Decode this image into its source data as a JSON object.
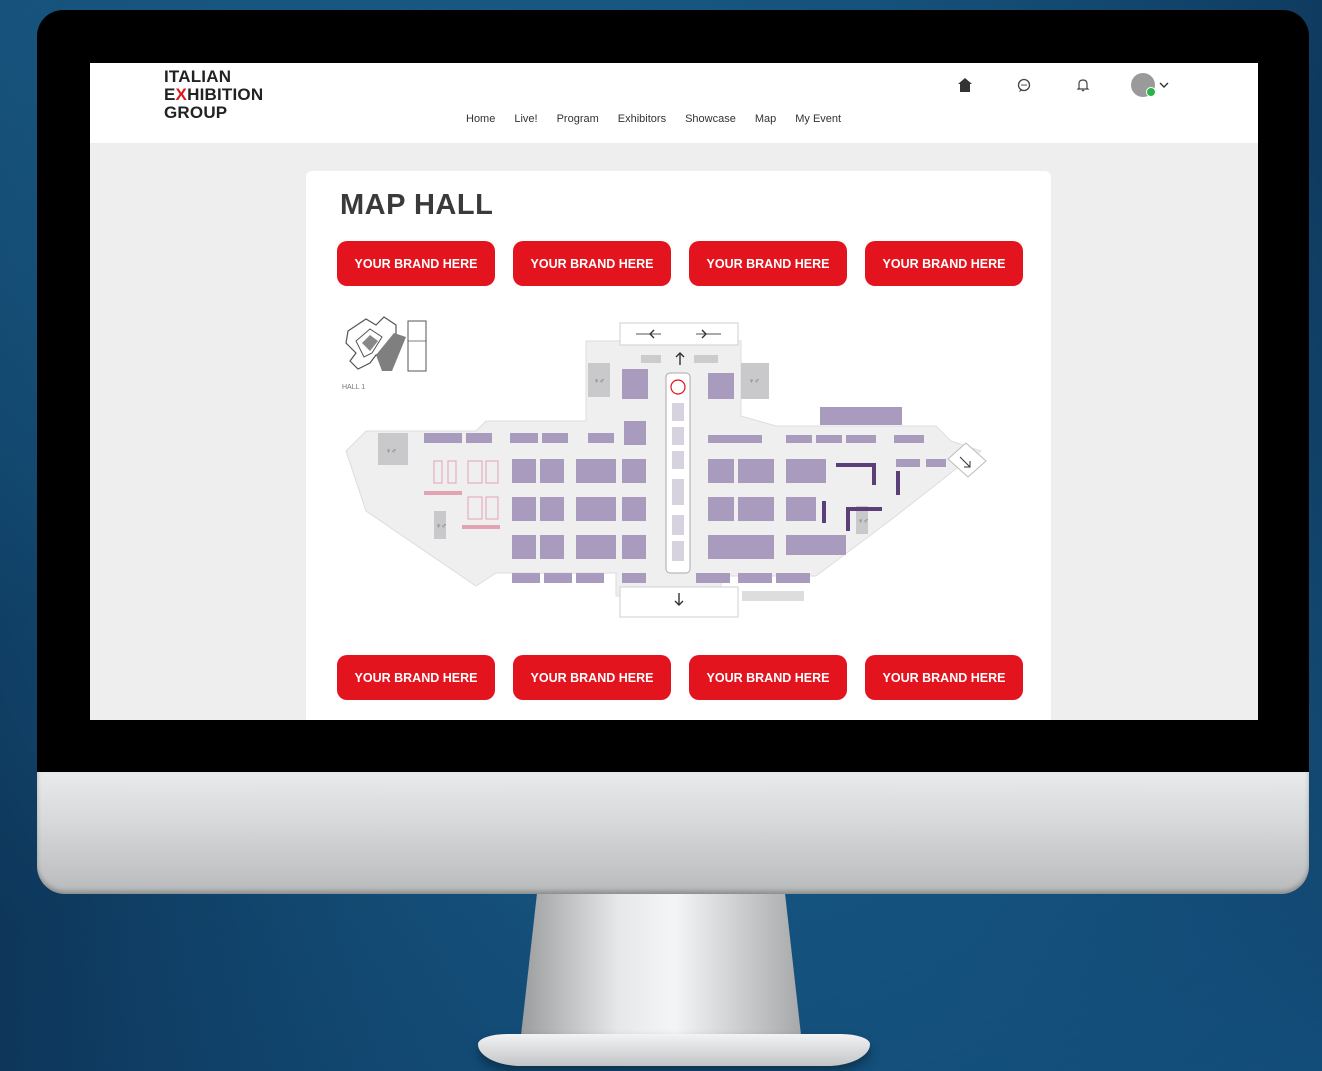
{
  "logo": {
    "line1": "ITALIAN",
    "line2_prefix": "E",
    "line2_x": "X",
    "line2_suffix": "HIBITION",
    "line3": "GROUP"
  },
  "nav": {
    "items": [
      {
        "label": "Home"
      },
      {
        "label": "Live!"
      },
      {
        "label": "Program"
      },
      {
        "label": "Exhibitors"
      },
      {
        "label": "Showcase"
      },
      {
        "label": "Map"
      },
      {
        "label": "My Event"
      }
    ]
  },
  "header_icons": [
    "home-icon",
    "chat-icon",
    "bell-icon",
    "avatar",
    "chevron-down-icon"
  ],
  "page": {
    "title": "MAP HALL"
  },
  "brand_buttons_top": [
    "YOUR BRAND HERE",
    "YOUR BRAND HERE",
    "YOUR BRAND HERE",
    "YOUR BRAND HERE"
  ],
  "brand_buttons_bottom": [
    "YOUR BRAND HERE",
    "YOUR BRAND HERE",
    "YOUR BRAND HERE",
    "YOUR BRAND HERE"
  ],
  "map": {
    "hall_label": "HALL 1"
  },
  "colors": {
    "brand_red": "#e3141d",
    "booth_purple": "#a89bbd",
    "booth_dark": "#5b3f78",
    "status_online": "#29b34a"
  }
}
